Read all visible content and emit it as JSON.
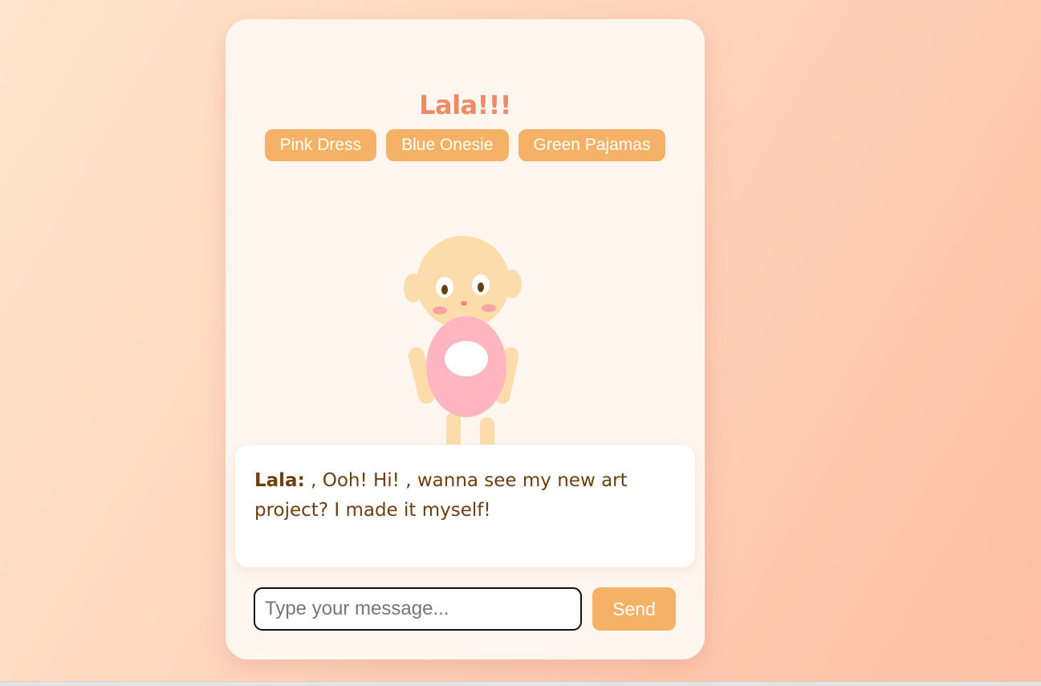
{
  "app": {
    "title": "Lala!!!"
  },
  "outfits": [
    {
      "label": "Pink Dress"
    },
    {
      "label": "Blue Onesie"
    },
    {
      "label": "Green Pajamas"
    }
  ],
  "baby": {
    "outfit_color": "#ffb6c1",
    "skin_color": "#fcdcaa"
  },
  "chat": {
    "speaker": "Lala:",
    "message": ", Ooh! Hi! , wanna see my new art project? I made it myself!"
  },
  "composer": {
    "placeholder": "Type your message...",
    "value": "",
    "send_label": "Send"
  },
  "colors": {
    "accent": "#f5b266",
    "title": "#ef8966",
    "text": "#6b3f12",
    "card": "#fff6ef"
  }
}
